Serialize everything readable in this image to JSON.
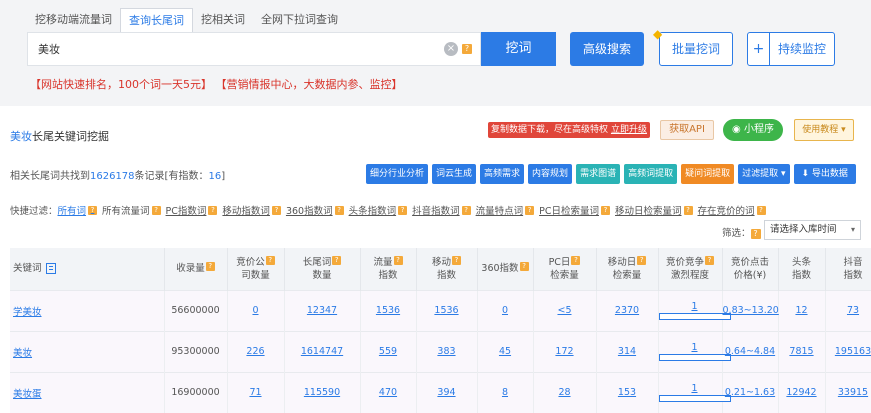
{
  "tabs": [
    {
      "label": "挖移动端流量词"
    },
    {
      "label": "查询长尾词"
    },
    {
      "label": "挖相关词"
    },
    {
      "label": "全网下拉词查询"
    }
  ],
  "search": {
    "value": "美妆",
    "clear_icon": "×",
    "help_icon": "?"
  },
  "buttons": {
    "dig": "挖词",
    "advanced": "高级搜索",
    "batch": "批量挖词",
    "monitor_plus": "+",
    "monitor": "持续监控"
  },
  "promo": {
    "item1": "【网站快速排名，100个词一天5元】",
    "item2": "【营销情报中心，大数据内参、监控】"
  },
  "section": {
    "title_highlight": "美妆",
    "title_rest": "长尾关键词挖掘",
    "promo_red": "复制数据下载，尽在高级特权",
    "promo_red_link": "立即升级",
    "api": "获取API",
    "mini_program": "小程序",
    "tutorial": "使用教程 ▾"
  },
  "summary": {
    "prefix": "相关长尾词共找到",
    "count": "1626178",
    "middle": "条记录[有指数：",
    "index_count": "16",
    "suffix": "]"
  },
  "toolbar": [
    {
      "label": "细分行业分析",
      "color": "blue"
    },
    {
      "label": "词云生成",
      "color": "blue"
    },
    {
      "label": "高频需求",
      "color": "blue"
    },
    {
      "label": "内容规划",
      "color": "blue"
    },
    {
      "label": "需求图谱",
      "color": "teal"
    },
    {
      "label": "高频词提取",
      "color": "teal"
    },
    {
      "label": "疑问词提取",
      "color": "orange"
    },
    {
      "label": "过滤提取 ▾",
      "color": "blue"
    },
    {
      "label": "导出数据",
      "color": "export",
      "icon": "download-icon"
    }
  ],
  "filters": {
    "label": "快捷过滤：",
    "items": [
      {
        "label": "所有词",
        "active": true
      },
      {
        "label": "所有流量词"
      },
      {
        "label": "PC指数词"
      },
      {
        "label": "移动指数词"
      },
      {
        "label": "360指数词"
      },
      {
        "label": "头条指数词"
      },
      {
        "label": "抖音指数词"
      },
      {
        "label": "流量特点词"
      },
      {
        "label": "PC日检索量词"
      },
      {
        "label": "移动日检索量词"
      },
      {
        "label": "存在竞价的词"
      }
    ]
  },
  "screen": {
    "label": "筛选：",
    "select_placeholder": "请选择入库时间",
    "arrow": "▾"
  },
  "table": {
    "headers": [
      {
        "label": "关键词",
        "sub": ""
      },
      {
        "label": "收录量",
        "sub": ""
      },
      {
        "label": "竞价公",
        "sub": "司数量"
      },
      {
        "label": "长尾词",
        "sub": "数量"
      },
      {
        "label": "流量",
        "sub": "指数"
      },
      {
        "label": "移动",
        "sub": "指数"
      },
      {
        "label": "360指数",
        "sub": ""
      },
      {
        "label": "PC日",
        "sub": "检索量"
      },
      {
        "label": "移动日",
        "sub": "检索量"
      },
      {
        "label": "竞价竞争",
        "sub": "激烈程度"
      },
      {
        "label": "竞价点击",
        "sub": "价格(¥)"
      },
      {
        "label": "头条",
        "sub": "指数"
      },
      {
        "label": "抖音",
        "sub": "指数"
      }
    ],
    "rows": [
      {
        "kw": "学美妆",
        "collected": "56600000",
        "bid_companies": "0",
        "longtail": "12347",
        "traffic": "1536",
        "mobile": "1536",
        "idx360": "0",
        "pc_daily": "<5",
        "mobile_daily": "2370",
        "compete": "1",
        "price": "0.83~13.20",
        "toutiao": "12",
        "douyin": "73"
      },
      {
        "kw": "美妆",
        "collected": "95300000",
        "bid_companies": "226",
        "longtail": "1614747",
        "traffic": "559",
        "mobile": "383",
        "idx360": "45",
        "pc_daily": "172",
        "mobile_daily": "314",
        "compete": "1",
        "price": "0.64~4.84",
        "toutiao": "7815",
        "douyin": "195163"
      },
      {
        "kw": "美妆蛋",
        "collected": "16900000",
        "bid_companies": "71",
        "longtail": "115590",
        "traffic": "470",
        "mobile": "394",
        "idx360": "8",
        "pc_daily": "28",
        "mobile_daily": "153",
        "compete": "1",
        "price": "0.21~1.63",
        "toutiao": "12942",
        "douyin": "33915"
      }
    ]
  },
  "colors": {
    "accent": "#2c7be5",
    "promo_red": "#d9342b",
    "teal": "#2ab3b5",
    "orange": "#f08a24",
    "green": "#3db54a"
  }
}
